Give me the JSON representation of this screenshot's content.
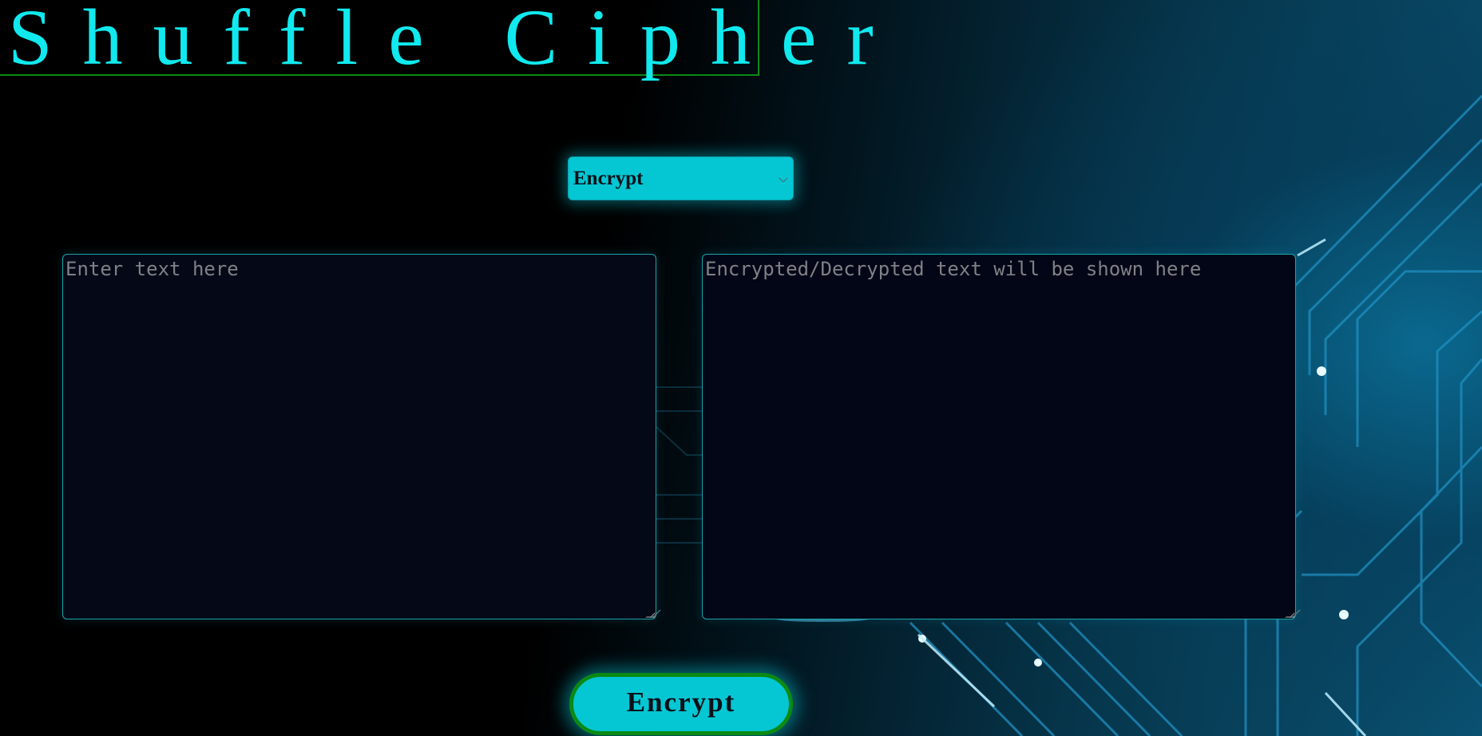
{
  "app": {
    "title": "Shuffle Cipher"
  },
  "mode": {
    "selected": "Encrypt",
    "options": [
      "Encrypt"
    ]
  },
  "input": {
    "value": "",
    "placeholder": "Enter text here"
  },
  "output": {
    "value": "",
    "placeholder": "Encrypted/Decrypted text will be shown here"
  },
  "action": {
    "label": "Encrypt"
  },
  "colors": {
    "title": "#10e9ee",
    "accent": "#05c6d3",
    "border_green": "#0a8a14",
    "background": "#000000"
  }
}
